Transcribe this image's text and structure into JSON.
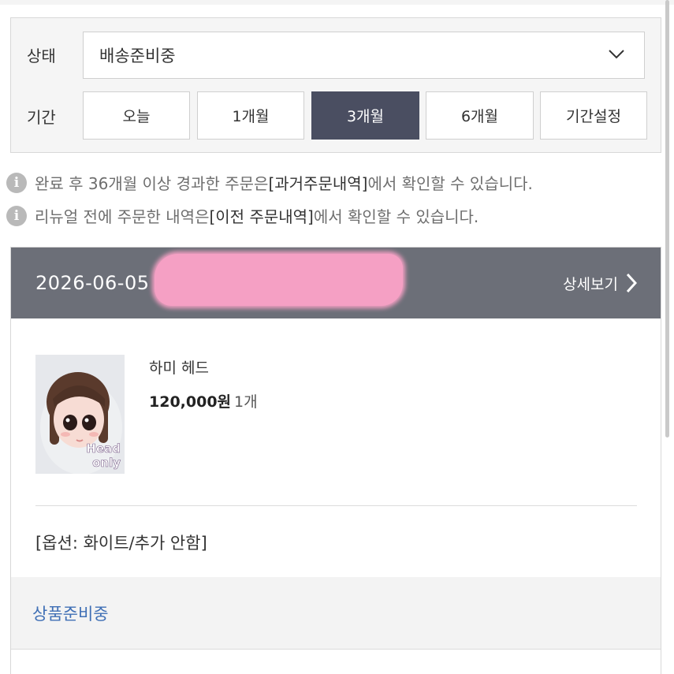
{
  "filter": {
    "status_label": "상태",
    "status_value": "배송준비중",
    "period_label": "기간",
    "periods": [
      "오늘",
      "1개월",
      "3개월",
      "6개월",
      "기간설정"
    ],
    "active_period": "3개월"
  },
  "notices": [
    {
      "pre": "완료 후 36개월 이상 경과한 주문은 ",
      "highlight": "[과거주문내역]",
      "post": "에서 확인할 수 있습니다."
    },
    {
      "pre": "리뉴얼 전에 주문한 내역은 ",
      "highlight": "[이전 주문내역]",
      "post": "에서 확인할 수 있습니다."
    }
  ],
  "order": {
    "date": "2026-06-05",
    "detail_label": "상세보기",
    "product": {
      "name": "하미 헤드",
      "price": "120,000원",
      "quantity": "1개",
      "thumb_caption": [
        "Head",
        "only"
      ],
      "option": "[옵션: 화이트/추가 안함]"
    },
    "status": "상품준비중"
  },
  "colors": {
    "active_period_bg": "#4a4e61",
    "order_header_bg": "#6c6f78",
    "status_text": "#3f6fb5",
    "redaction": "#f5a0c4"
  }
}
